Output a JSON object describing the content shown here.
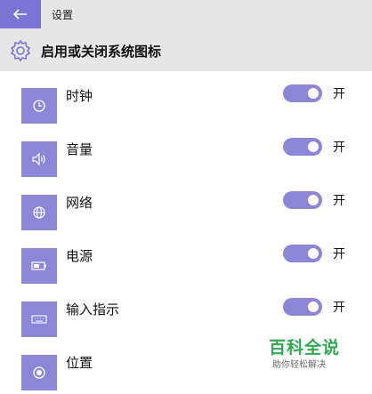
{
  "window": {
    "title": "设置"
  },
  "header": {
    "title": "启用或关闭系统图标"
  },
  "settings": [
    {
      "label": "时钟",
      "icon": "clock-icon",
      "state": "开",
      "on": true
    },
    {
      "label": "音量",
      "icon": "volume-icon",
      "state": "开",
      "on": true
    },
    {
      "label": "网络",
      "icon": "network-globe-icon",
      "state": "开",
      "on": true
    },
    {
      "label": "电源",
      "icon": "battery-icon",
      "state": "开",
      "on": true
    },
    {
      "label": "输入指示",
      "icon": "keyboard-icon",
      "state": "开",
      "on": true
    },
    {
      "label": "位置",
      "icon": "location-icon"
    }
  ],
  "watermark": {
    "brand": "百科全说",
    "tagline": "助你轻松解决"
  },
  "colors": {
    "accent": "#8c86d8",
    "back_button": "#7b74d4",
    "header_bg": "#e6e6e6",
    "watermark": "#2fa84f"
  }
}
